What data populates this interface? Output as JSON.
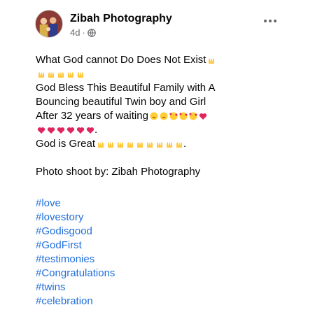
{
  "header": {
    "page_name": "Zibah Photography",
    "time": "4d",
    "separator": "·",
    "privacy_icon": "globe-icon",
    "more_icon": "more-options-icon"
  },
  "post": {
    "lines": [
      "What God cannot Do Does Not Exist",
      "",
      "God Bless This Beautiful Family with A",
      "Bouncing beautiful Twin boy and Girl",
      "After 32 years of waiting",
      ".",
      "God is Great",
      "",
      "Photo shoot by: Zibah Photography"
    ],
    "line7_end": "."
  },
  "hashtags": [
    "#love",
    "#lovestory",
    "#Godisgood",
    "#GodFirst",
    "#testimonies",
    "#Congratulations",
    "#twins",
    "#celebration"
  ],
  "colors": {
    "hashtag": "#216fdb",
    "meta": "#65676b",
    "text": "#050505"
  }
}
